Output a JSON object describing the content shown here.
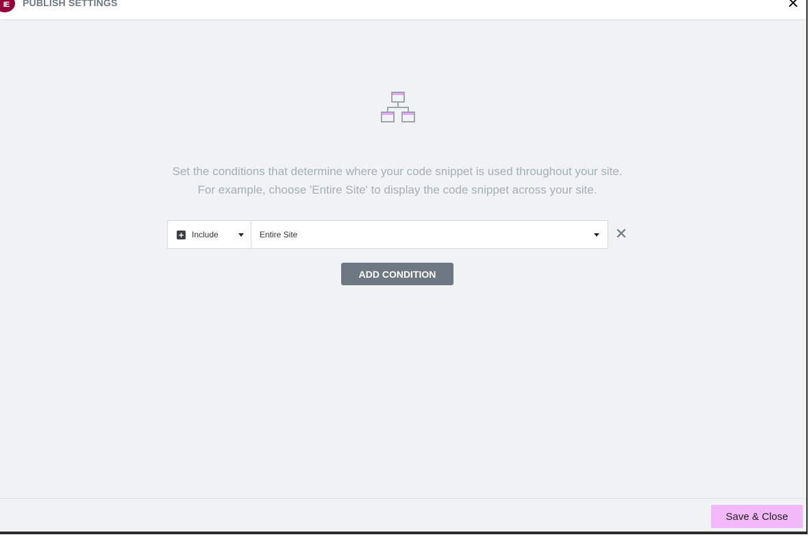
{
  "header": {
    "logo_icon": "elementor-logo-icon",
    "logo_glyph": "IE",
    "title": "PUBLISH SETTINGS",
    "close_glyph": "✕"
  },
  "main": {
    "illustration_icon": "site-structure-icon",
    "intro_line1": "Set the conditions that determine where your code snippet is used throughout your site.",
    "intro_line2": "For example, choose 'Entire Site' to display the code snippet across your site."
  },
  "condition": {
    "type_icon": "plus-square-icon",
    "type_value": "Include",
    "scope_value": "Entire Site",
    "remove_glyph": "✕"
  },
  "actions": {
    "add_condition_label": "ADD CONDITION",
    "save_close_label": "Save & Close"
  },
  "colors": {
    "brand": "#92003b",
    "accent_pink": "#f3b8f8",
    "button_gray": "#6d7882",
    "background": "#f1f2f4"
  }
}
